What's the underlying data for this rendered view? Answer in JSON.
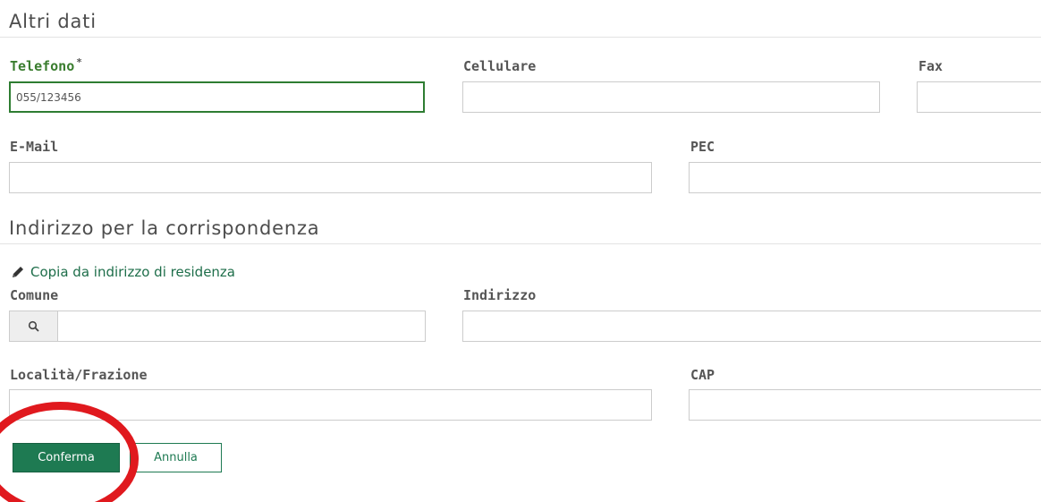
{
  "sections": {
    "altri_dati": "Altri dati",
    "indirizzo": "Indirizzo per la corrispondenza"
  },
  "fields": {
    "telefono": {
      "label": "Telefono",
      "required_marker": "*",
      "value": "055/123456"
    },
    "cellulare": {
      "label": "Cellulare",
      "value": ""
    },
    "fax": {
      "label": "Fax",
      "value": ""
    },
    "email": {
      "label": "E-Mail",
      "value": ""
    },
    "pec": {
      "label": "PEC",
      "value": ""
    },
    "comune": {
      "label": "Comune",
      "value": ""
    },
    "indirizzo": {
      "label": "Indirizzo",
      "value": ""
    },
    "localita": {
      "label": "Località/Frazione",
      "value": ""
    },
    "cap": {
      "label": "CAP",
      "value": ""
    }
  },
  "copy_link": {
    "label": "Copia da indirizzo di residenza",
    "icon": "pencil-icon"
  },
  "search_icon": "search-icon",
  "buttons": {
    "confirm": "Conferma",
    "cancel": "Annulla"
  },
  "colors": {
    "accent": "#1e7a52",
    "focus_border": "#2e7d32",
    "highlight_circle": "#e0191e"
  }
}
